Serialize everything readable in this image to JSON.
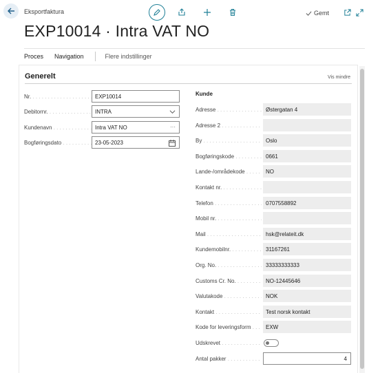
{
  "page": {
    "caption": "Eksportfaktura",
    "title": "EXP10014 · Intra VAT NO",
    "saved_label": "Gemt"
  },
  "actions": {
    "proces": "Proces",
    "navigation": "Navigation",
    "more": "Flere indstillinger"
  },
  "general": {
    "title": "Generelt",
    "show_less": "Vis mindre",
    "fields": [
      {
        "label": "Nr.",
        "value": "EXP10014"
      },
      {
        "label": "Debitornr.",
        "value": "INTRA"
      },
      {
        "label": "Kundenavn",
        "value": "Intra VAT NO"
      },
      {
        "label": "Bogføringsdato",
        "value": "23-05-2023"
      }
    ]
  },
  "customer": {
    "title": "Kunde",
    "fields": [
      {
        "label": "Adresse",
        "value": "Østergatan 4"
      },
      {
        "label": "Adresse 2",
        "value": ""
      },
      {
        "label": "By",
        "value": "Oslo"
      },
      {
        "label": "Bogføringskode",
        "value": "0661"
      },
      {
        "label": "Lande-/områdekode",
        "value": "NO"
      },
      {
        "label": "Kontakt nr.",
        "value": ""
      },
      {
        "label": "Telefon",
        "value": "0707558892"
      },
      {
        "label": "Mobil nr.",
        "value": ""
      },
      {
        "label": "Mail",
        "value": "hsk@relateit.dk"
      },
      {
        "label": "Kundemobilnr.",
        "value": "31167261"
      },
      {
        "label": "Org. No.",
        "value": "33333333333"
      },
      {
        "label": "Customs Cr. No.",
        "value": "NO-12445646"
      },
      {
        "label": "Valutakode",
        "value": "NOK"
      },
      {
        "label": "Kontakt",
        "value": "Test norsk kontakt"
      },
      {
        "label": "Kode for leveringsform",
        "value": "EXW"
      },
      {
        "label": "Udskrevet",
        "value": false
      },
      {
        "label": "Antal pakker",
        "value": "4"
      }
    ]
  },
  "icons": {
    "back": "back-arrow-icon",
    "edit": "pencil-icon",
    "share": "share-icon",
    "new": "plus-icon",
    "delete": "trash-icon",
    "saved": "checkmark-icon",
    "popout": "open-in-new-window-icon",
    "expand": "expand-icon",
    "lookup": "ellipsis-icon",
    "dropdown": "chevron-down-icon",
    "calendar": "calendar-icon"
  },
  "colors": {
    "accent": "#1e7f96"
  }
}
